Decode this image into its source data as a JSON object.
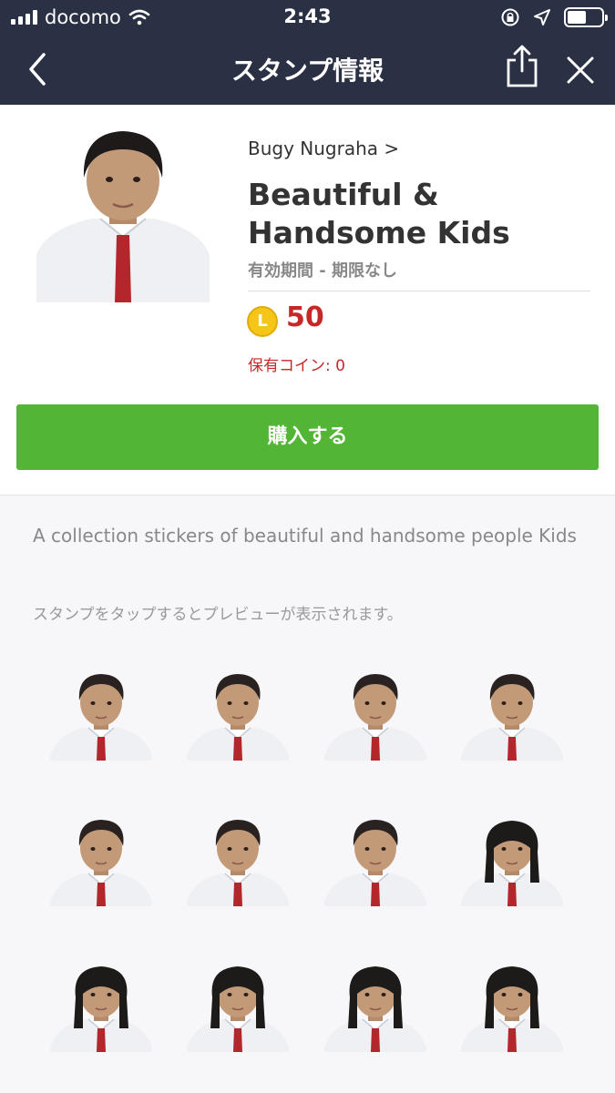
{
  "status_bar": {
    "carrier": "docomo",
    "time": "2:43"
  },
  "nav": {
    "title": "スタンプ情報",
    "back_icon": "chevron-left-icon",
    "share_icon": "share-icon",
    "close_icon": "close-icon"
  },
  "sticker_pack": {
    "author": "Bugy Nugraha >",
    "title": "Beautiful & Handsome Kids",
    "validity": "有効期間 - 期限なし",
    "coin_symbol": "L",
    "price": "50",
    "owned_coins": "保有コイン: 0",
    "buy_label": "購入する",
    "description": "A collection stickers of beautiful and handsome people Kids",
    "hint": "スタンプをタップするとプレビューが表示されます。"
  },
  "stickers": [
    {
      "hair": "#2a2220",
      "long_hair": false
    },
    {
      "hair": "#2a2220",
      "long_hair": false
    },
    {
      "hair": "#2a2220",
      "long_hair": false
    },
    {
      "hair": "#2a2220",
      "long_hair": false
    },
    {
      "hair": "#2a2220",
      "long_hair": false
    },
    {
      "hair": "#2a2220",
      "long_hair": false
    },
    {
      "hair": "#2a2220",
      "long_hair": false
    },
    {
      "hair": "#1d1a1a",
      "long_hair": true
    },
    {
      "hair": "#1d1a1a",
      "long_hair": true
    },
    {
      "hair": "#1d1a1a",
      "long_hair": true
    },
    {
      "hair": "#1d1a1a",
      "long_hair": true
    },
    {
      "hair": "#1d1a1a",
      "long_hair": true
    }
  ],
  "colors": {
    "nav_bg": "#2b3145",
    "buy_green": "#53b535",
    "price_red": "#c62828",
    "tie_red": "#b3262b"
  }
}
